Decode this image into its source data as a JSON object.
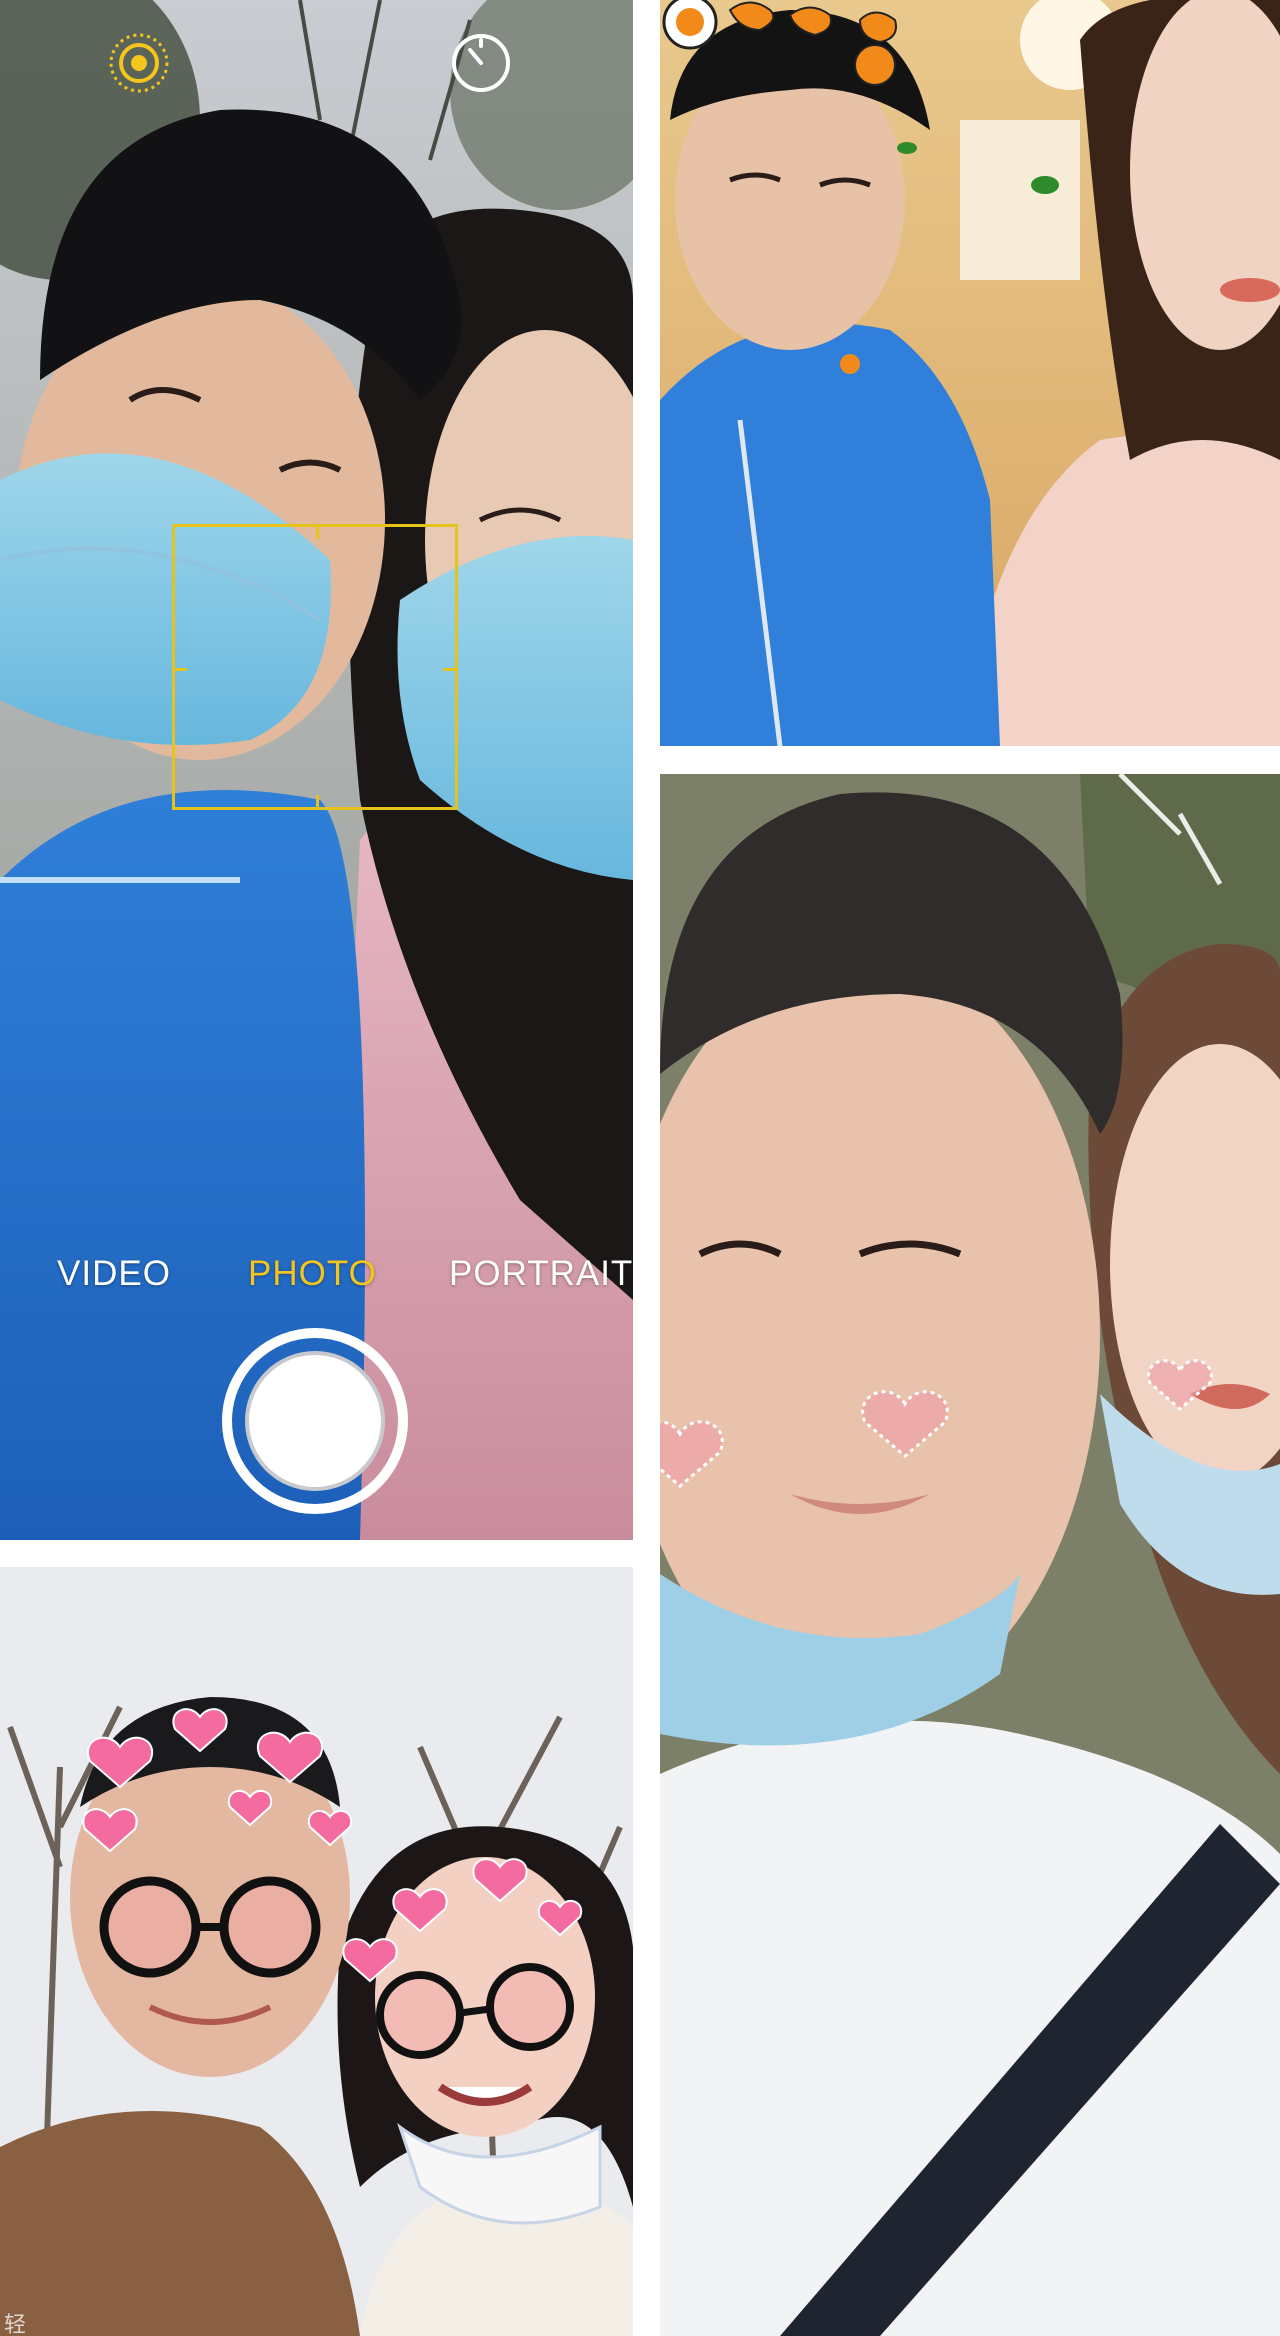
{
  "camera": {
    "modes": [
      {
        "label": "VIDEO",
        "selected": false
      },
      {
        "label": "PHOTO",
        "selected": true
      },
      {
        "label": "PORTRAIT",
        "selected": false
      }
    ],
    "accent_color": "#f4c51c",
    "icons": {
      "top_left": "live-photo-icon",
      "top_right": "timer-icon"
    }
  },
  "collage": {
    "panels": [
      "camera-viewfinder-selfie",
      "orange-sticker-selfie",
      "heart-glasses-filter-selfie",
      "heart-cheek-filter-selfie"
    ]
  },
  "watermark": {
    "text": "轻"
  }
}
